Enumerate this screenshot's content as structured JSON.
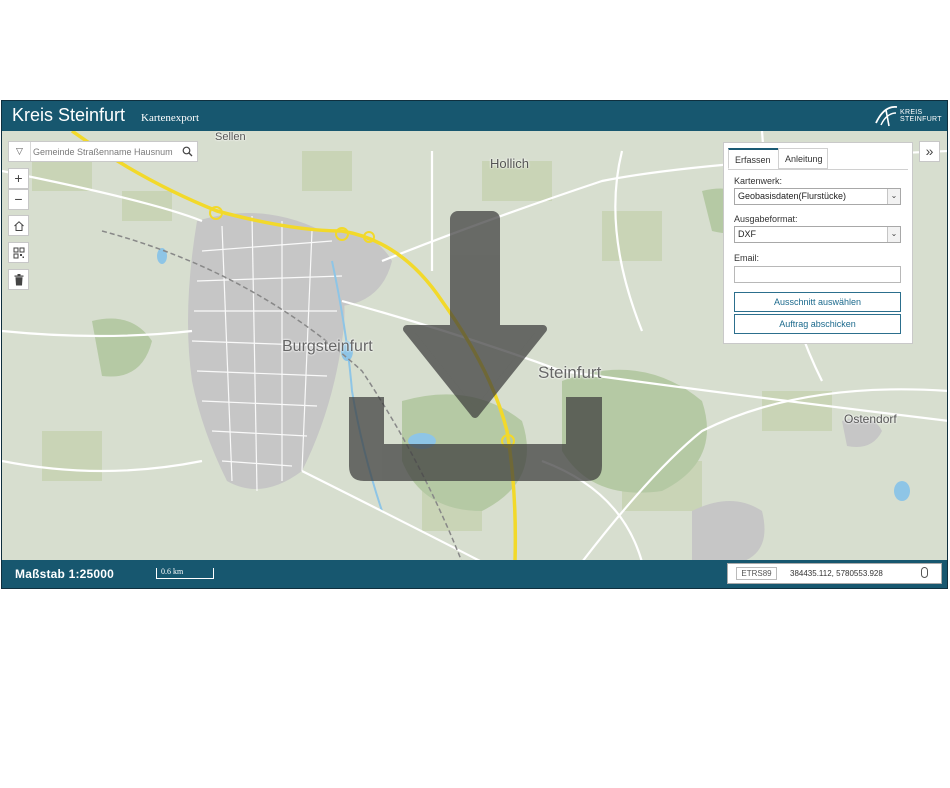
{
  "header": {
    "title": "Kreis Steinfurt",
    "subtitle": "Kartenexport",
    "logo_text_line1": "KREIS",
    "logo_text_line2": "STEINFURT"
  },
  "search": {
    "placeholder": "Gemeinde Straßenname Hausnum"
  },
  "map": {
    "labels": {
      "sellen": "Sellen",
      "hollich": "Hollich",
      "burgsteinfurt": "Burgsteinfurt",
      "steinfurt": "Steinfurt",
      "ostendorf": "Ostendorf"
    }
  },
  "panel": {
    "tabs": [
      "Erfassen",
      "Anleitung"
    ],
    "kartenwerk_label": "Kartenwerk:",
    "kartenwerk_value": "Geobasisdaten(Flurstücke)",
    "format_label": "Ausgabeformat:",
    "format_value": "DXF",
    "email_label": "Email:",
    "email_value": "",
    "select_area_button": "Ausschnitt auswählen",
    "submit_button": "Auftrag abschicken"
  },
  "footer": {
    "scale": "Maßstab 1:25000",
    "scalebar": "0.6 km",
    "crs": "ETRS89",
    "coordinates": "384435.112, 5780553.928"
  },
  "colors": {
    "header_bg": "#17576f",
    "accent": "#1c6a8d",
    "motorway": "#f2d92a",
    "urban": "#c4c4c4",
    "forest": "#a9c39b"
  },
  "icons": {
    "zoom_in": "plus-icon",
    "zoom_out": "minus-icon",
    "home": "home-icon",
    "qr": "qr-code-icon",
    "delete": "trash-icon",
    "expand": "double-chevron-right-icon",
    "download": "download-arrow-icon"
  }
}
